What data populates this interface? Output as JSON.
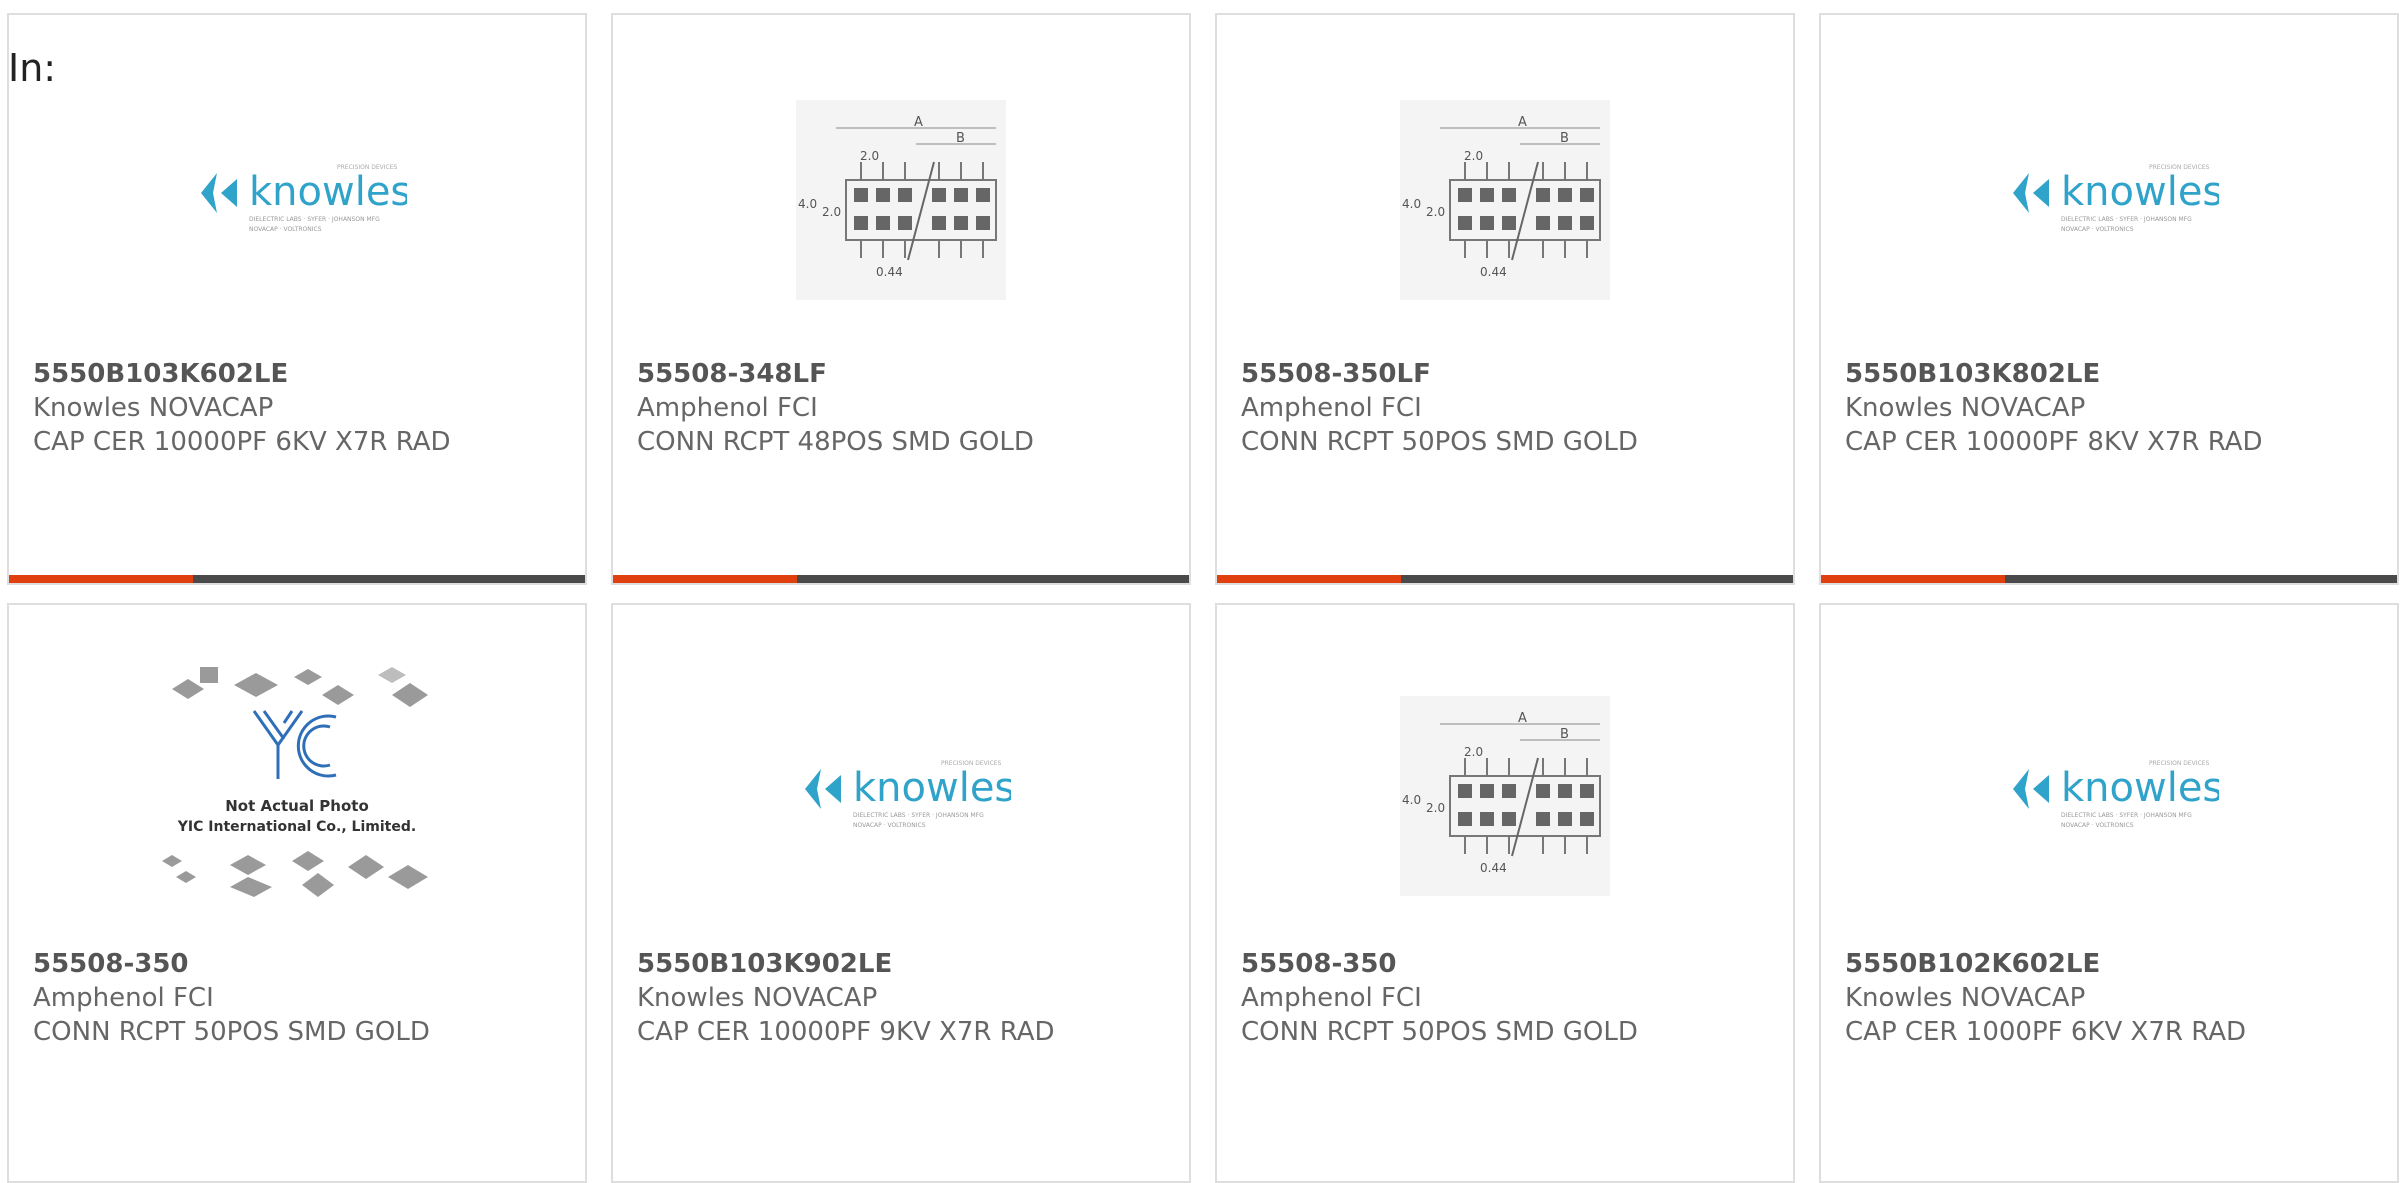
{
  "header": {
    "in_label": "In:"
  },
  "colors": {
    "accent": "#e04010",
    "bar": "#4a4a4a",
    "border": "#dedede",
    "logo_blue": "#2fa3c9"
  },
  "products": [
    {
      "part_number": "5550B103K602LE",
      "manufacturer": "Knowles NOVACAP",
      "description": "CAP CER 10000PF 6KV X7R RAD",
      "image": "knowles-logo"
    },
    {
      "part_number": "55508-348LF",
      "manufacturer": "Amphenol FCI",
      "description": "CONN RCPT 48POS SMD GOLD",
      "image": "connector-diagram"
    },
    {
      "part_number": "55508-350LF",
      "manufacturer": "Amphenol FCI",
      "description": "CONN RCPT 50POS SMD GOLD",
      "image": "connector-diagram"
    },
    {
      "part_number": "5550B103K802LE",
      "manufacturer": "Knowles NOVACAP",
      "description": "CAP CER 10000PF 8KV X7R RAD",
      "image": "knowles-logo"
    },
    {
      "part_number": "55508-350",
      "manufacturer": "Amphenol FCI",
      "description": "CONN RCPT 50POS SMD GOLD",
      "image": "yic-placeholder"
    },
    {
      "part_number": "5550B103K902LE",
      "manufacturer": "Knowles NOVACAP",
      "description": "CAP CER 10000PF 9KV X7R RAD",
      "image": "knowles-logo"
    },
    {
      "part_number": "55508-350",
      "manufacturer": "Amphenol FCI",
      "description": "CONN RCPT 50POS SMD GOLD",
      "image": "connector-diagram"
    },
    {
      "part_number": "5550B102K602LE",
      "manufacturer": "Knowles NOVACAP",
      "description": "CAP CER 1000PF 6KV X7R RAD",
      "image": "knowles-logo"
    }
  ],
  "logos": {
    "knowles_word": "knowles",
    "knowles_tag": "PRECISION DEVICES",
    "knowles_line1": "DIELECTRIC LABS · SYFER · JOHANSON MFG",
    "knowles_line2": "NOVACAP · VOLTRONICS"
  },
  "diagram_labels": {
    "a": "A",
    "b": "B",
    "pitch": "2.0",
    "height": "4.0",
    "row": "2.0",
    "pin": "0.44"
  },
  "yic": {
    "line1": "Not Actual Photo",
    "line2": "YIC International Co., Limited."
  }
}
